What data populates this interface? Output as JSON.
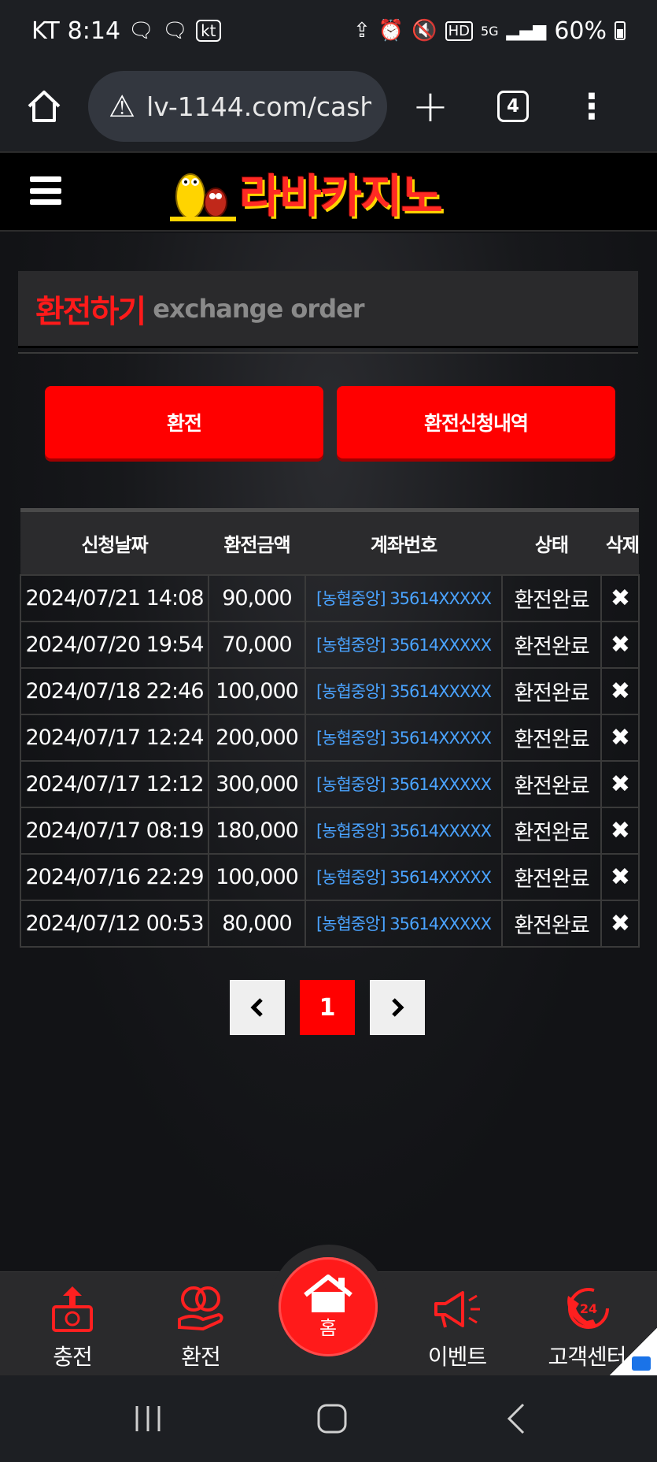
{
  "status_bar": {
    "carrier": "KT",
    "time": "8:14",
    "kt_badge": "kt",
    "battery": "60%"
  },
  "browser": {
    "url": "lv-1144.com/cash",
    "tab_count": "4"
  },
  "site": {
    "logo_text": "라바카지노"
  },
  "page": {
    "title_ko": "환전하기",
    "title_en": "exchange order",
    "btn_exchange": "환전",
    "btn_history": "환전신청내역"
  },
  "table": {
    "headers": [
      "신청날짜",
      "환전금액",
      "계좌번호",
      "상태",
      "삭제"
    ],
    "rows": [
      {
        "date": "2024/07/21 14:08",
        "amount": "90,000",
        "account": "[농협중앙] 35614XXXXX",
        "status": "환전완료"
      },
      {
        "date": "2024/07/20 19:54",
        "amount": "70,000",
        "account": "[농협중앙] 35614XXXXX",
        "status": "환전완료"
      },
      {
        "date": "2024/07/18 22:46",
        "amount": "100,000",
        "account": "[농협중앙] 35614XXXXX",
        "status": "환전완료"
      },
      {
        "date": "2024/07/17 12:24",
        "amount": "200,000",
        "account": "[농협중앙] 35614XXXXX",
        "status": "환전완료"
      },
      {
        "date": "2024/07/17 12:12",
        "amount": "300,000",
        "account": "[농협중앙] 35614XXXXX",
        "status": "환전완료"
      },
      {
        "date": "2024/07/17 08:19",
        "amount": "180,000",
        "account": "[농협중앙] 35614XXXXX",
        "status": "환전완료"
      },
      {
        "date": "2024/07/16 22:29",
        "amount": "100,000",
        "account": "[농협중앙] 35614XXXXX",
        "status": "환전완료"
      },
      {
        "date": "2024/07/12 00:53",
        "amount": "80,000",
        "account": "[농협중앙] 35614XXXXX",
        "status": "환전완료"
      }
    ],
    "delete_icon": "close-icon"
  },
  "pagination": {
    "current": "1",
    "prev_icon": "chevron-left-icon",
    "next_icon": "chevron-right-icon"
  },
  "bottom_nav": {
    "charge": "충전",
    "exchange": "환전",
    "home": "홈",
    "event": "이벤트",
    "support": "고객센터"
  },
  "colors": {
    "accent_red": "#ff0000",
    "account_blue": "#4aa3ff",
    "panel": "#2a2a2c"
  }
}
